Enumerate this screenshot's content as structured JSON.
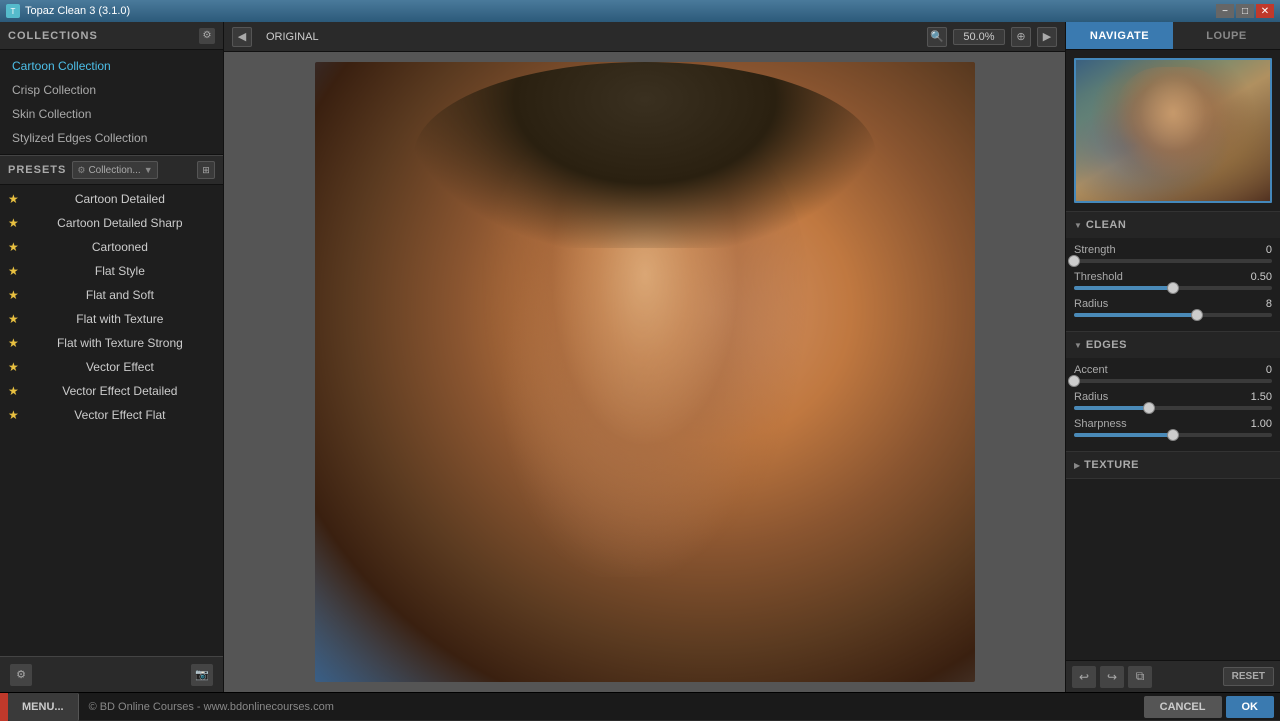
{
  "titlebar": {
    "title": "Topaz Clean 3 (3.1.0)",
    "min": "−",
    "max": "□",
    "close": "✕"
  },
  "sidebar": {
    "collections_label": "COLLECTIONS",
    "collections": [
      {
        "id": "cartoon",
        "label": "Cartoon Collection",
        "active": true
      },
      {
        "id": "crisp",
        "label": "Crisp Collection",
        "active": false
      },
      {
        "id": "skin",
        "label": "Skin Collection",
        "active": false
      },
      {
        "id": "stylized",
        "label": "Stylized Edges Collection",
        "active": false
      }
    ],
    "presets_label": "PRESETS",
    "presets_dropdown": "Collection...",
    "presets": [
      {
        "label": "Cartoon Detailed"
      },
      {
        "label": "Cartoon Detailed Sharp"
      },
      {
        "label": "Cartooned"
      },
      {
        "label": "Flat Style"
      },
      {
        "label": "Flat and Soft"
      },
      {
        "label": "Flat with Texture"
      },
      {
        "label": "Flat with Texture Strong"
      },
      {
        "label": "Vector Effect"
      },
      {
        "label": "Vector Effect Detailed"
      },
      {
        "label": "Vector Effect Flat"
      }
    ]
  },
  "toolbar": {
    "original_label": "ORIGINAL",
    "zoom": "50.0%"
  },
  "right_panel": {
    "nav_tab": "NAVIGATE",
    "loupe_tab": "LOUPE",
    "sections": {
      "clean": {
        "title": "CLEAN",
        "sliders": [
          {
            "label": "Strength",
            "value": "0",
            "pct": 0
          },
          {
            "label": "Threshold",
            "value": "0.50",
            "pct": 50
          },
          {
            "label": "Radius",
            "value": "8",
            "pct": 62
          }
        ]
      },
      "edges": {
        "title": "EDGES",
        "sliders": [
          {
            "label": "Accent",
            "value": "0",
            "pct": 0
          },
          {
            "label": "Radius",
            "value": "1.50",
            "pct": 38
          },
          {
            "label": "Sharpness",
            "value": "1.00",
            "pct": 50
          }
        ]
      },
      "texture": {
        "title": "TEXTURE"
      }
    },
    "buttons": {
      "undo": "↩",
      "redo": "↪",
      "reset_label": "RESET"
    }
  },
  "bottom": {
    "menu_label": "MENU...",
    "copyright": "© BD Online Courses - www.bdonlinecourses.com",
    "cancel_label": "CANCEL",
    "ok_label": "OK"
  }
}
